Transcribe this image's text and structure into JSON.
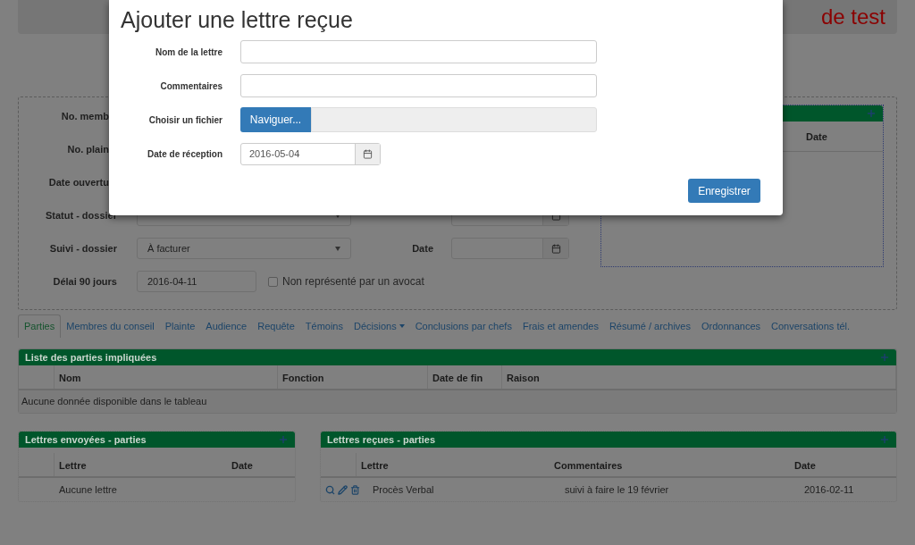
{
  "header": {
    "title": "de test"
  },
  "form": {
    "covered_labels": [
      "No. memb",
      "No. plain",
      "Date ouvertu"
    ],
    "rows": [
      {
        "kind": "select_date",
        "label": "Statut - dossier"
      },
      {
        "kind": "select_date",
        "label": "Suivi - dossier",
        "value": "À facturer",
        "date_label": "Date"
      },
      {
        "kind": "date_check",
        "label": "Délai 90 jours",
        "value": "2016-04-11",
        "checkbox": {
          "label": "Non représenté par un avocat",
          "checked": false
        }
      }
    ],
    "side_panel": {
      "columns": [
        "Date"
      ]
    }
  },
  "tabs": [
    {
      "label": "Parties",
      "selected": true
    },
    {
      "label": "Membres du conseil",
      "selected": false
    },
    {
      "label": "Plainte",
      "selected": false
    },
    {
      "label": "Audience",
      "selected": false
    },
    {
      "label": "Requête",
      "selected": false
    },
    {
      "label": "Témoins",
      "selected": false
    },
    {
      "label": "Décisions",
      "selected": false,
      "dropdown": true
    },
    {
      "label": "Conclusions par chefs",
      "selected": false
    },
    {
      "label": "Frais et amendes",
      "selected": false
    },
    {
      "label": "Résumé / archives",
      "selected": false
    },
    {
      "label": "Ordonnances",
      "selected": false
    },
    {
      "label": "Conversations tél.",
      "selected": false
    }
  ],
  "parties": {
    "title": "Liste des parties impliquées",
    "columns": [
      "Nom",
      "Fonction",
      "Date de fin",
      "Raison"
    ],
    "empty_message": "Aucune donnée disponible dans le tableau"
  },
  "letters_sent": {
    "title": "Lettres envoyées - parties",
    "columns": [
      "Lettre",
      "Date"
    ],
    "empty_message": "Aucune lettre"
  },
  "letters_received": {
    "title": "Lettres reçues - parties",
    "columns": [
      "Lettre",
      "Commentaires",
      "Date"
    ],
    "rows": [
      {
        "cells": [
          "Procès Verbal",
          "suivi à faire le 19 février",
          "2016-02-11"
        ]
      }
    ]
  },
  "dialog": {
    "title": "Ajouter une lettre reçue",
    "fields": [
      {
        "kind": "text",
        "label": "Nom de la lettre"
      },
      {
        "kind": "text",
        "label": "Commentaires"
      },
      {
        "kind": "file",
        "label": "Choisir un fichier",
        "button": "Naviguer..."
      },
      {
        "kind": "date",
        "label": "Date de réception",
        "value": "2016-05-04"
      }
    ],
    "save_button": "Enregistrer"
  }
}
